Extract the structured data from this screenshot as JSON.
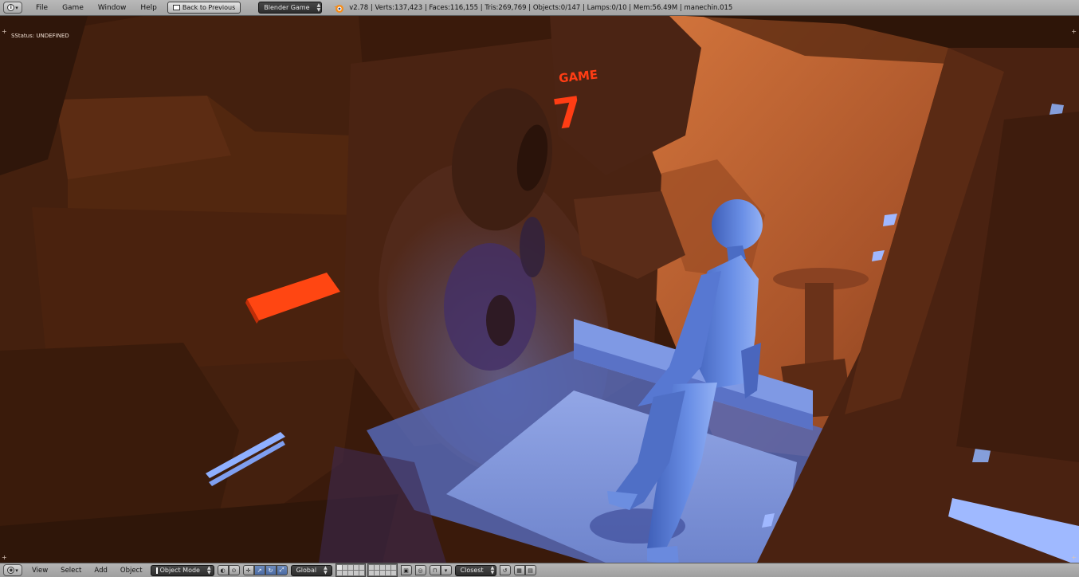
{
  "top_header": {
    "menus": [
      "File",
      "Game",
      "Window",
      "Help"
    ],
    "back_button": "Back to Previous",
    "engine": "Blender Game",
    "stats": "v2.78 | Verts:137,423 | Faces:116,155 | Tris:269,769 | Objects:0/147 | Lamps:0/10 | Mem:56.49M | manechin.015",
    "icons": [
      "info-editor-icon",
      "blender-logo-icon"
    ]
  },
  "viewport": {
    "status_text": "SStatus: UNDEFINED",
    "scene_sign_text": "GAME",
    "scene_sign_number": "7",
    "colors": {
      "background": "#2b1408",
      "warm_wall": "#a95124",
      "neon_panel": "#ff4010",
      "cool_light": "#7f9fe4",
      "figure": "#5a7ed8"
    }
  },
  "bottom_header": {
    "menus": [
      "View",
      "Select",
      "Add",
      "Object"
    ],
    "mode": "Object Mode",
    "orientation": "Global",
    "snap_target": "Closest",
    "icons": [
      "3d-view-editor-icon",
      "viewport-shading-icon",
      "pivot-point-icon",
      "manipulator-toggle-icon",
      "translate-icon",
      "rotate-icon",
      "scale-icon",
      "layer-buttons",
      "lock-icon",
      "snap-icon",
      "proportional-edit-icon",
      "render-icon"
    ]
  }
}
